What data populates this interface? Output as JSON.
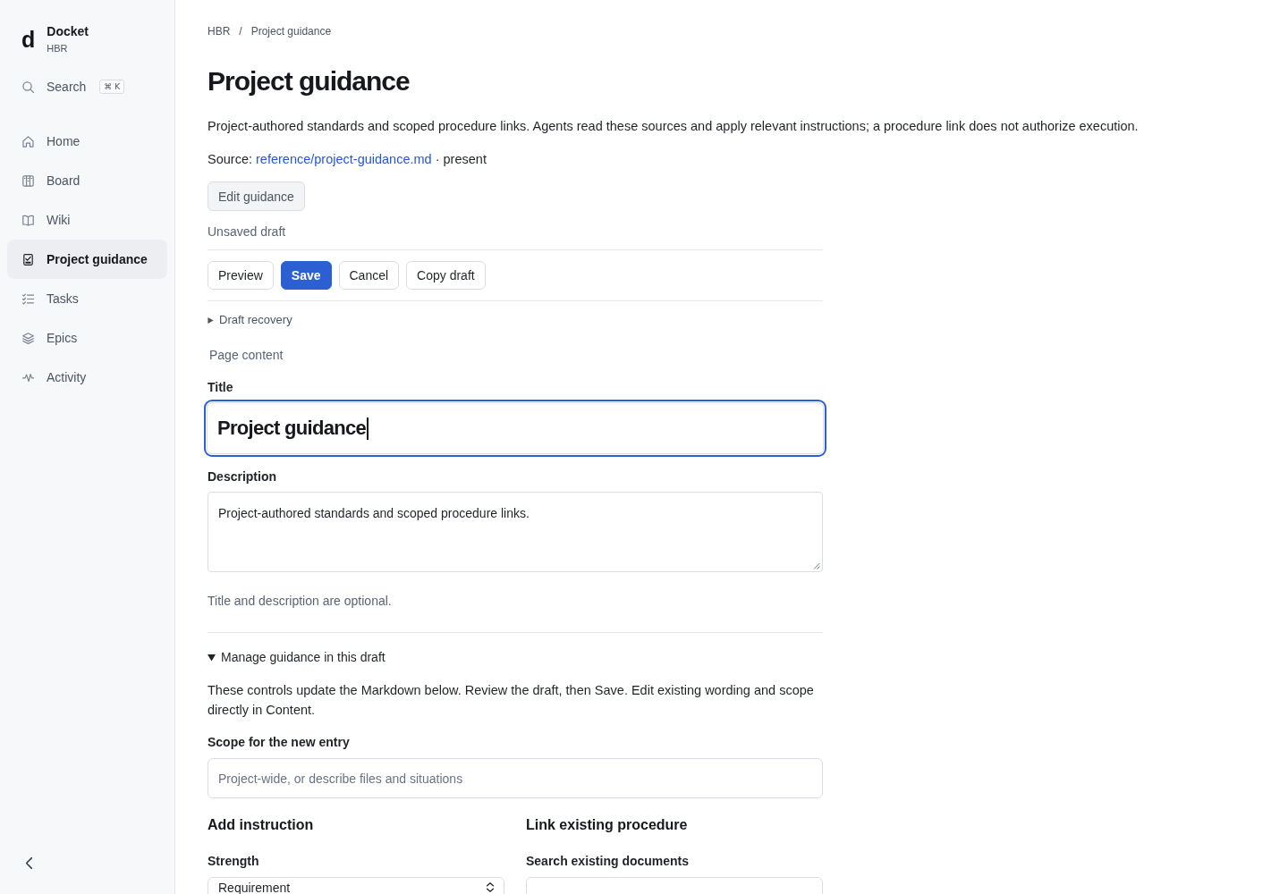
{
  "sidebar": {
    "brand": {
      "mark": "d",
      "name": "Docket",
      "workspace": "HBR"
    },
    "search": {
      "label": "Search",
      "shortcut": "⌘ K"
    },
    "items": [
      {
        "label": "Home",
        "selected": false
      },
      {
        "label": "Board",
        "selected": false
      },
      {
        "label": "Wiki",
        "selected": false
      },
      {
        "label": "Project guidance",
        "selected": true
      },
      {
        "label": "Tasks",
        "selected": false
      },
      {
        "label": "Epics",
        "selected": false
      },
      {
        "label": "Activity",
        "selected": false
      }
    ]
  },
  "breadcrumb": {
    "items": [
      "HBR",
      "Project guidance"
    ],
    "separator": "/"
  },
  "page": {
    "title": "Project guidance",
    "description": "Project-authored standards and scoped procedure links. Agents read these sources and apply relevant instructions; a procedure link does not authorize execution.",
    "source": {
      "label": "Source:",
      "link": "reference/project-guidance.md",
      "status": "· present"
    },
    "edit_button": "Edit guidance"
  },
  "draft": {
    "status": "Unsaved draft",
    "actions": [
      {
        "label": "Preview",
        "kind": "secondary"
      },
      {
        "label": "Save",
        "kind": "primary"
      },
      {
        "label": "Cancel",
        "kind": "secondary"
      },
      {
        "label": "Copy draft",
        "kind": "secondary"
      }
    ],
    "recovery": {
      "label": "Draft recovery",
      "expanded": false
    }
  },
  "page_content": {
    "legend": "Page content",
    "title_field": {
      "label": "Title",
      "value": "Project guidance",
      "focused": true
    },
    "description_field": {
      "label": "Description",
      "value": "Project-authored standards and scoped procedure links."
    },
    "hint": "Title and description are optional."
  },
  "manage": {
    "label": "Manage guidance in this draft",
    "expanded": true,
    "intro": "These controls update the Markdown below. Review the draft, then Save. Edit existing wording and scope directly in Content.",
    "scope_field": {
      "label": "Scope for the new entry",
      "placeholder": "Project-wide, or describe files and situations"
    },
    "add_instruction": {
      "heading": "Add instruction",
      "strength_field": {
        "label": "Strength",
        "value": "Requirement"
      }
    },
    "link_procedure": {
      "heading": "Link existing procedure",
      "search_field": {
        "label": "Search existing documents"
      }
    }
  }
}
